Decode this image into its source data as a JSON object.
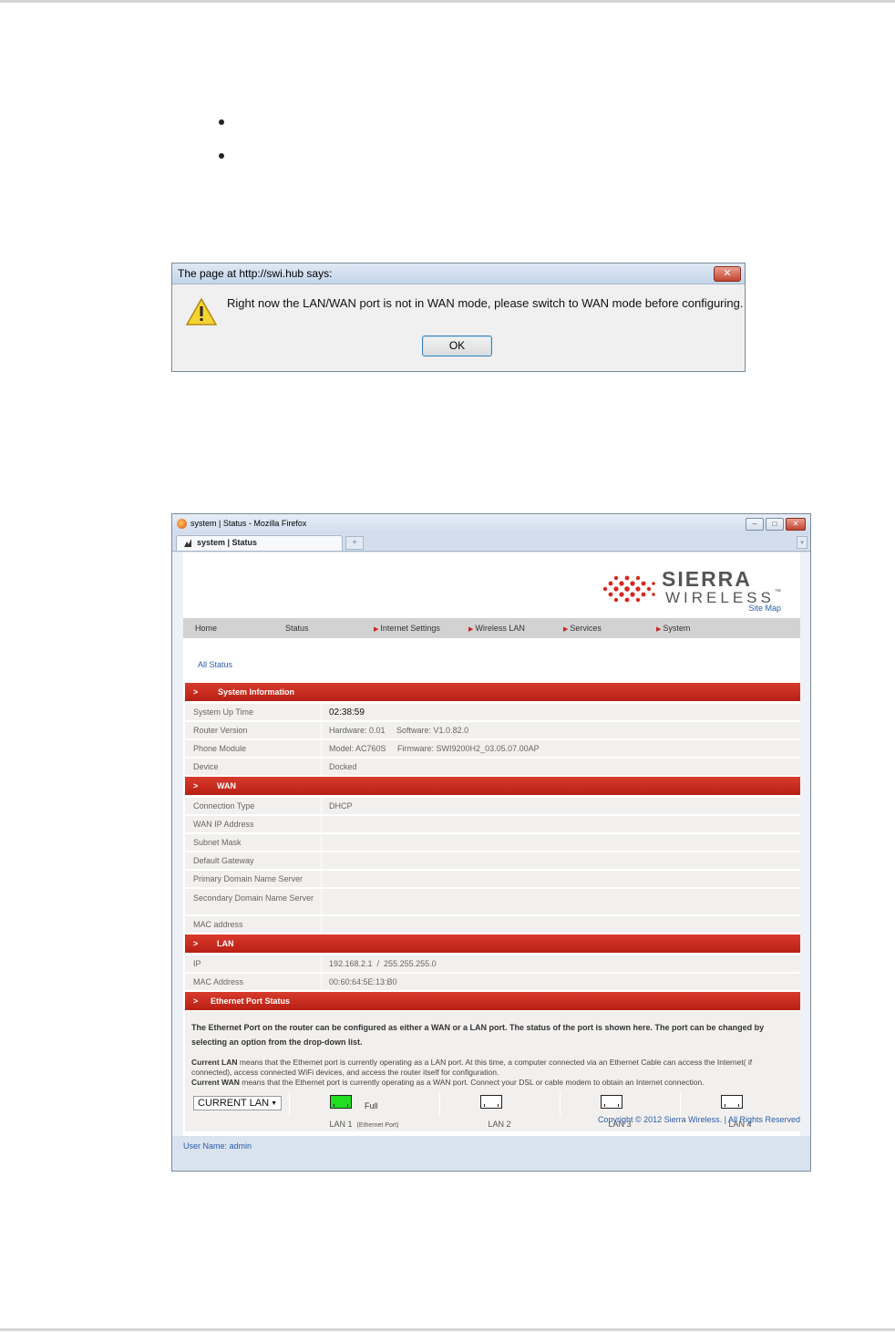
{
  "dialog": {
    "title": "The page at http://swi.hub says:",
    "close_glyph": "✕",
    "message": "Right now the LAN/WAN port is not in WAN mode, please switch to WAN mode before configuring.",
    "ok_label": "OK"
  },
  "browser": {
    "title": "system | Status - Mozilla Firefox",
    "tab_label": "system | Status",
    "newtab_glyph": "+",
    "win_min": "–",
    "win_max": "□",
    "win_close": "✕"
  },
  "logo": {
    "line1": "SIERRA",
    "line2": "WIRELESS",
    "tm": "™"
  },
  "nav": {
    "sitemap": "Site Map",
    "items": [
      "Home",
      "Status",
      "Internet Settings",
      "Wireless LAN",
      "Services",
      "System"
    ],
    "all_status": "All Status"
  },
  "system_info": {
    "header": "System Information",
    "rows": [
      {
        "label": "System Up Time",
        "value": "02:38:59"
      },
      {
        "label": "Router Version",
        "value": "Hardware: 0.01     Software: V1.0.82.0"
      },
      {
        "label": "Phone Module",
        "value": "Model: AC760S     Firmware: SWI9200H2_03.05.07.00AP"
      },
      {
        "label": "Device",
        "value": "Docked"
      }
    ]
  },
  "wan": {
    "header": "WAN",
    "rows": [
      {
        "label": "Connection Type",
        "value": "DHCP"
      },
      {
        "label": "WAN IP Address",
        "value": ""
      },
      {
        "label": "Subnet Mask",
        "value": ""
      },
      {
        "label": "Default Gateway",
        "value": ""
      },
      {
        "label": "Primary Domain Name Server",
        "value": ""
      },
      {
        "label": "Secondary Domain Name Server",
        "value": ""
      },
      {
        "label": "MAC address",
        "value": ""
      }
    ]
  },
  "lan": {
    "header": "LAN",
    "rows": [
      {
        "label": "IP",
        "value": "192.168.2.1  /  255.255.255.0"
      },
      {
        "label": "MAC Address",
        "value": "00:60:64:5E:13:B0"
      }
    ]
  },
  "ethernet": {
    "header": "Ethernet Port Status",
    "intro": "The Ethernet Port on the router can be configured as either a WAN or a LAN port. The status of the port is shown here. The port can be changed by selecting an option from the drop-down list.",
    "lan_term": "Current LAN",
    "lan_desc": " means that the Ethernet port is currently operating as a LAN port. At this time, a computer connected via an Ethernet Cable can access the Internet( if connected), access connected WiFi devices, and access the router itself for configuration.",
    "wan_term": "Current WAN",
    "wan_desc": " means that the Ethernet port is currently operating as a WAN port. Connect your DSL or cable modem to obtain an Internet connection.",
    "mode_selected": "CURRENT LAN",
    "port1_status": "Full",
    "port1_label": "LAN 1",
    "port1_sub": "(Ethernet Port)",
    "port_labels": [
      "LAN 2",
      "LAN 3",
      "LAN 4"
    ]
  },
  "footer": {
    "user": "User Name:   admin",
    "copyright": "Copyright © 2012 Sierra Wireless. | All Rights Reserved"
  }
}
